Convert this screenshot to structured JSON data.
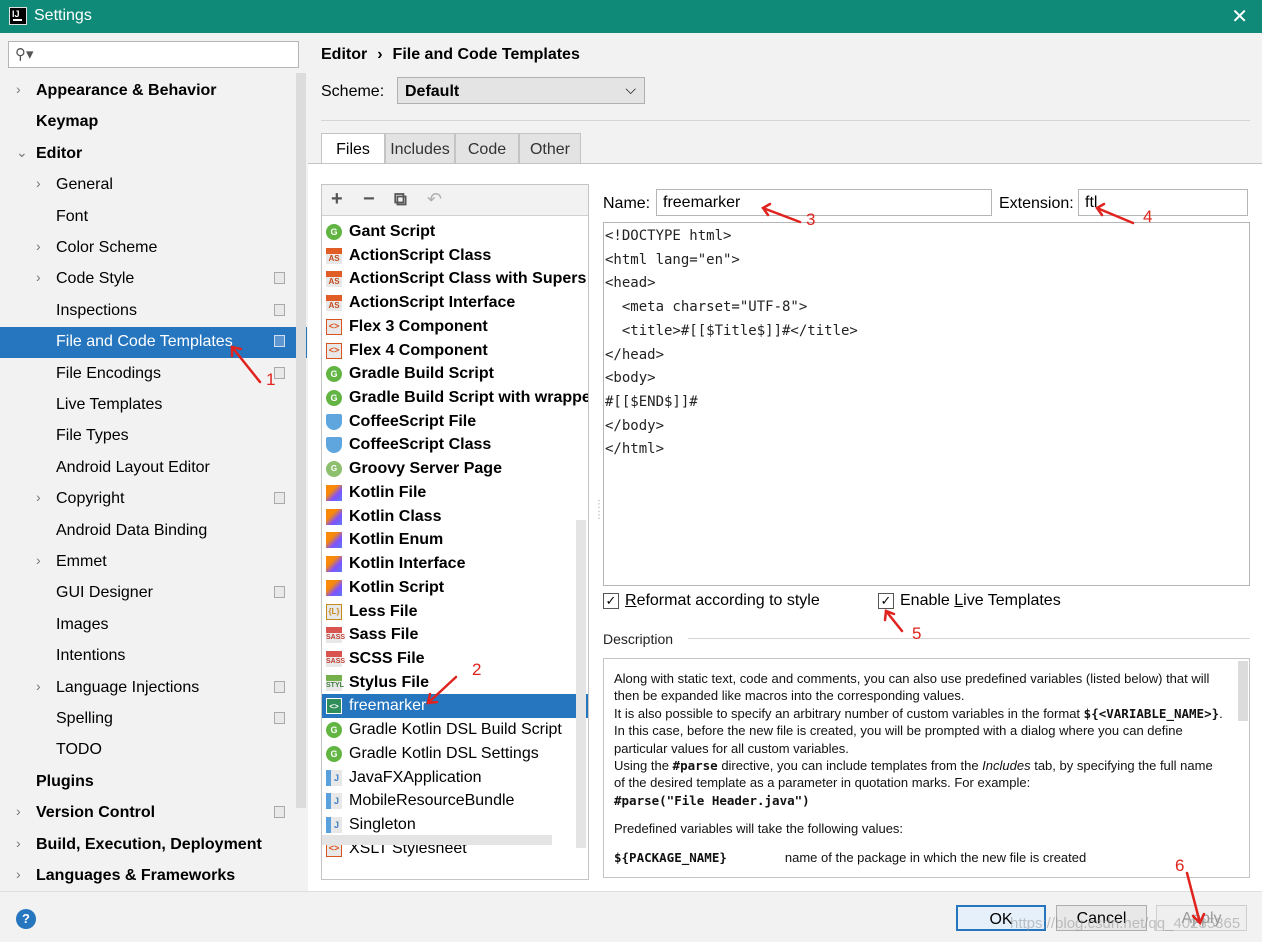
{
  "window": {
    "title": "Settings",
    "close_glyph": "✕",
    "app_icon": "intellij-icon"
  },
  "search": {
    "placeholder": "",
    "value": ""
  },
  "sidebar": {
    "items": [
      {
        "label": "Appearance & Behavior",
        "bold": true,
        "arrow": "›",
        "indent": 0,
        "ext": false,
        "selected": false
      },
      {
        "label": "Keymap",
        "bold": true,
        "arrow": "",
        "indent": 0,
        "ext": false,
        "selected": false
      },
      {
        "label": "Editor",
        "bold": true,
        "arrow": "⌄",
        "indent": 0,
        "ext": false,
        "selected": false
      },
      {
        "label": "General",
        "bold": false,
        "arrow": "›",
        "indent": 1,
        "ext": false,
        "selected": false
      },
      {
        "label": "Font",
        "bold": false,
        "arrow": "",
        "indent": 1,
        "ext": false,
        "selected": false
      },
      {
        "label": "Color Scheme",
        "bold": false,
        "arrow": "›",
        "indent": 1,
        "ext": false,
        "selected": false
      },
      {
        "label": "Code Style",
        "bold": false,
        "arrow": "›",
        "indent": 1,
        "ext": true,
        "selected": false
      },
      {
        "label": "Inspections",
        "bold": false,
        "arrow": "",
        "indent": 1,
        "ext": true,
        "selected": false
      },
      {
        "label": "File and Code Templates",
        "bold": false,
        "arrow": "",
        "indent": 1,
        "ext": true,
        "selected": true
      },
      {
        "label": "File Encodings",
        "bold": false,
        "arrow": "",
        "indent": 1,
        "ext": true,
        "selected": false
      },
      {
        "label": "Live Templates",
        "bold": false,
        "arrow": "",
        "indent": 1,
        "ext": false,
        "selected": false
      },
      {
        "label": "File Types",
        "bold": false,
        "arrow": "",
        "indent": 1,
        "ext": false,
        "selected": false
      },
      {
        "label": "Android Layout Editor",
        "bold": false,
        "arrow": "",
        "indent": 1,
        "ext": false,
        "selected": false
      },
      {
        "label": "Copyright",
        "bold": false,
        "arrow": "›",
        "indent": 1,
        "ext": true,
        "selected": false
      },
      {
        "label": "Android Data Binding",
        "bold": false,
        "arrow": "",
        "indent": 1,
        "ext": false,
        "selected": false
      },
      {
        "label": "Emmet",
        "bold": false,
        "arrow": "›",
        "indent": 1,
        "ext": false,
        "selected": false
      },
      {
        "label": "GUI Designer",
        "bold": false,
        "arrow": "",
        "indent": 1,
        "ext": true,
        "selected": false
      },
      {
        "label": "Images",
        "bold": false,
        "arrow": "",
        "indent": 1,
        "ext": false,
        "selected": false
      },
      {
        "label": "Intentions",
        "bold": false,
        "arrow": "",
        "indent": 1,
        "ext": false,
        "selected": false
      },
      {
        "label": "Language Injections",
        "bold": false,
        "arrow": "›",
        "indent": 1,
        "ext": true,
        "selected": false
      },
      {
        "label": "Spelling",
        "bold": false,
        "arrow": "",
        "indent": 1,
        "ext": true,
        "selected": false
      },
      {
        "label": "TODO",
        "bold": false,
        "arrow": "",
        "indent": 1,
        "ext": false,
        "selected": false
      },
      {
        "label": "Plugins",
        "bold": true,
        "arrow": "",
        "indent": 0,
        "ext": false,
        "selected": false
      },
      {
        "label": "Version Control",
        "bold": true,
        "arrow": "›",
        "indent": 0,
        "ext": true,
        "selected": false
      },
      {
        "label": "Build, Execution, Deployment",
        "bold": true,
        "arrow": "›",
        "indent": 0,
        "ext": false,
        "selected": false
      },
      {
        "label": "Languages & Frameworks",
        "bold": true,
        "arrow": "›",
        "indent": 0,
        "ext": false,
        "selected": false
      }
    ]
  },
  "breadcrumb": {
    "parent": "Editor",
    "separator": "›",
    "current": "File and Code Templates"
  },
  "scheme": {
    "label": "Scheme:",
    "value": "Default",
    "chevron": "⌵"
  },
  "tabs": [
    {
      "label": "Files",
      "active": true
    },
    {
      "label": "Includes",
      "active": false
    },
    {
      "label": "Code",
      "active": false
    },
    {
      "label": "Other",
      "active": false
    }
  ],
  "toolbar": {
    "add": "+",
    "remove": "−",
    "copy": "⧉",
    "reset": "↶"
  },
  "templates": [
    {
      "label": "Gant Script",
      "icon": "g",
      "glyph": "G",
      "bold": true,
      "selected": false
    },
    {
      "label": "ActionScript Class",
      "icon": "as",
      "glyph": "AS",
      "bold": true,
      "selected": false
    },
    {
      "label": "ActionScript Class with Supers",
      "icon": "as",
      "glyph": "AS",
      "bold": true,
      "selected": false
    },
    {
      "label": "ActionScript Interface",
      "icon": "as",
      "glyph": "AS",
      "bold": true,
      "selected": false
    },
    {
      "label": "Flex 3 Component",
      "icon": "fx",
      "glyph": "<>",
      "bold": true,
      "selected": false
    },
    {
      "label": "Flex 4 Component",
      "icon": "fx",
      "glyph": "<>",
      "bold": true,
      "selected": false
    },
    {
      "label": "Gradle Build Script",
      "icon": "g",
      "glyph": "G",
      "bold": true,
      "selected": false
    },
    {
      "label": "Gradle Build Script with wrapper",
      "icon": "g",
      "glyph": "G",
      "bold": true,
      "selected": false
    },
    {
      "label": "CoffeeScript File",
      "icon": "cf",
      "glyph": "",
      "bold": true,
      "selected": false
    },
    {
      "label": "CoffeeScript Class",
      "icon": "cf",
      "glyph": "",
      "bold": true,
      "selected": false
    },
    {
      "label": "Groovy Server Page",
      "icon": "gr",
      "glyph": "G",
      "bold": true,
      "selected": false
    },
    {
      "label": "Kotlin File",
      "icon": "kt",
      "glyph": "",
      "bold": true,
      "selected": false
    },
    {
      "label": "Kotlin Class",
      "icon": "kt",
      "glyph": "",
      "bold": true,
      "selected": false
    },
    {
      "label": "Kotlin Enum",
      "icon": "kt",
      "glyph": "",
      "bold": true,
      "selected": false
    },
    {
      "label": "Kotlin Interface",
      "icon": "kt",
      "glyph": "",
      "bold": true,
      "selected": false
    },
    {
      "label": "Kotlin Script",
      "icon": "kt",
      "glyph": "",
      "bold": true,
      "selected": false
    },
    {
      "label": "Less File",
      "icon": "less",
      "glyph": "{L}",
      "bold": true,
      "selected": false
    },
    {
      "label": "Sass File",
      "icon": "sass",
      "glyph": "SASS",
      "bold": true,
      "selected": false
    },
    {
      "label": "SCSS File",
      "icon": "sass",
      "glyph": "SASS",
      "bold": true,
      "selected": false
    },
    {
      "label": "Stylus File",
      "icon": "styl",
      "glyph": "STYL",
      "bold": true,
      "selected": false
    },
    {
      "label": "freemarker",
      "icon": "fm",
      "glyph": "<>",
      "bold": false,
      "selected": true
    },
    {
      "label": "Gradle Kotlin DSL Build Script",
      "icon": "g",
      "glyph": "G",
      "bold": false,
      "selected": false
    },
    {
      "label": "Gradle Kotlin DSL Settings",
      "icon": "g",
      "glyph": "G",
      "bold": false,
      "selected": false
    },
    {
      "label": "JavaFXApplication",
      "icon": "j",
      "glyph": "J",
      "bold": false,
      "selected": false
    },
    {
      "label": "MobileResourceBundle",
      "icon": "j",
      "glyph": "J",
      "bold": false,
      "selected": false
    },
    {
      "label": "Singleton",
      "icon": "j",
      "glyph": "J",
      "bold": false,
      "selected": false
    },
    {
      "label": "XSLT Stylesheet",
      "icon": "x",
      "glyph": "<>",
      "bold": false,
      "selected": false
    }
  ],
  "form": {
    "name_label": "Name:",
    "name_value": "freemarker",
    "extension_label": "Extension:",
    "extension_value": "ftl"
  },
  "code_lines": [
    "<!DOCTYPE html>",
    "<html lang=\"en\">",
    "<head>",
    "  <meta charset=\"UTF-8\">",
    "  <title>#[[$Title$]]#</title>",
    "</head>",
    "<body>",
    "#[[$END$]]#",
    "</body>",
    "</html>"
  ],
  "options": {
    "reformat_label_pre": "",
    "reformat_label_mnemonic": "R",
    "reformat_label_post": "eformat according to style",
    "reformat_checked": true,
    "live_label_pre": "Enable ",
    "live_label_mnemonic": "L",
    "live_label_post": "ive Templates",
    "live_checked": true,
    "check_glyph": "✓"
  },
  "description": {
    "label": "Description",
    "p1": "Along with static text, code and comments, you can also use predefined variables (listed below) that will then be expanded like macros into the corresponding values.",
    "p2a": "It is also possible to specify an arbitrary number of custom variables in the format",
    "p2code": "${<VARIABLE_NAME>}",
    "p2b": ". In this case, before the new file is created, you will be prompted with a dialog where you can define particular values for all custom variables.",
    "p3a": "Using the ",
    "p3code": "#parse",
    "p3b": " directive, you can include templates from the ",
    "p3em": "Includes",
    "p3c": " tab, by specifying the full name of the desired template as a parameter in quotation marks. For example:",
    "p3example": "#parse(\"File Header.java\")",
    "p4": "Predefined variables will take the following values:",
    "p5code": "${PACKAGE_NAME}",
    "p5text": "name of the package in which the new file is created"
  },
  "buttons": {
    "help": "?",
    "ok": "OK",
    "cancel": "Cancel",
    "apply": "Apply"
  },
  "annotations": [
    "1",
    "2",
    "3",
    "4",
    "5",
    "6"
  ],
  "watermark": "https://blog.csdn.net/qq_40235865",
  "colors": {
    "titlebar": "#0f8a78",
    "selection": "#2675bf",
    "annotation": "#e0231e"
  }
}
